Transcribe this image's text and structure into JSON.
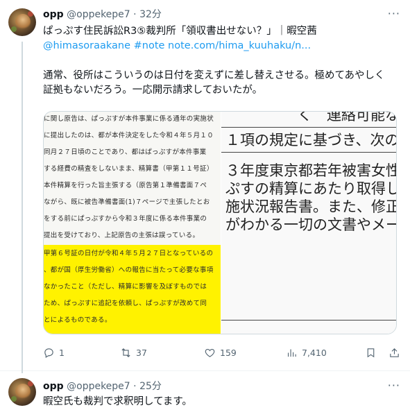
{
  "tweets": [
    {
      "author_name": "opp",
      "handle": "@oppekepe7",
      "separator": "·",
      "time": "32分",
      "more": "···",
      "line1": "ぱっぷす住民訴訟R3⑤裁判所「領収書出せない？」｜暇空茜",
      "line2": "@himasoraakane #note note.com/hima_kuuhaku/n...",
      "body1": "通常、役所はこういうのは日付を変えずに差し替えさせる。極めてあやしく",
      "body2": "証拠もないだろう。一応開示請求しておいたが。",
      "doc_left_lines": [
        "に関し原告は、ぱっぷすが本件事業に係る通年の実施状",
        "に提出したのは、都が本件決定をした令和４年５月１０",
        "同月２７日頃のことであり、都はぱっぷすが本件事業",
        "する経費の精査をしないまま、精算書（甲第１１号証）",
        "本件精算を行った旨主張する（原告第１準備書面７ペ",
        "ながら、既に被告準備書面(1)７ページで主張したとお",
        "をする前にぱっぷすから令和３年度に係る本件事業の",
        "提出を受けており、上記原告の主張は誤っている。",
        "甲第６号証の日付が令和４年５月２７日となっているの",
        "、都が国（厚生労働省）への報告に当たって必要な事項",
        "なかったこと（ただし、精算に影響を及ぼすものでは",
        "ため、ぱっぷすに追記を依頼し、ぱっぷすが改めて同",
        "とによるものである。"
      ],
      "doc_right_lines": [
        "く　連絡可能な",
        "１項の規定に基づき、次の",
        "３年度東京都若年被害女性",
        "ぷすの精算にあたり取得し",
        "施状況報告書。また、修正",
        "がわかる一切の文書やメー"
      ],
      "replies": "1",
      "retweets": "37",
      "likes": "159",
      "views": "7,410"
    },
    {
      "author_name": "opp",
      "handle": "@oppekepe7",
      "separator": "·",
      "time": "25分",
      "more": "···",
      "body1": "暇空氏も裁判で求釈明してます。"
    }
  ]
}
